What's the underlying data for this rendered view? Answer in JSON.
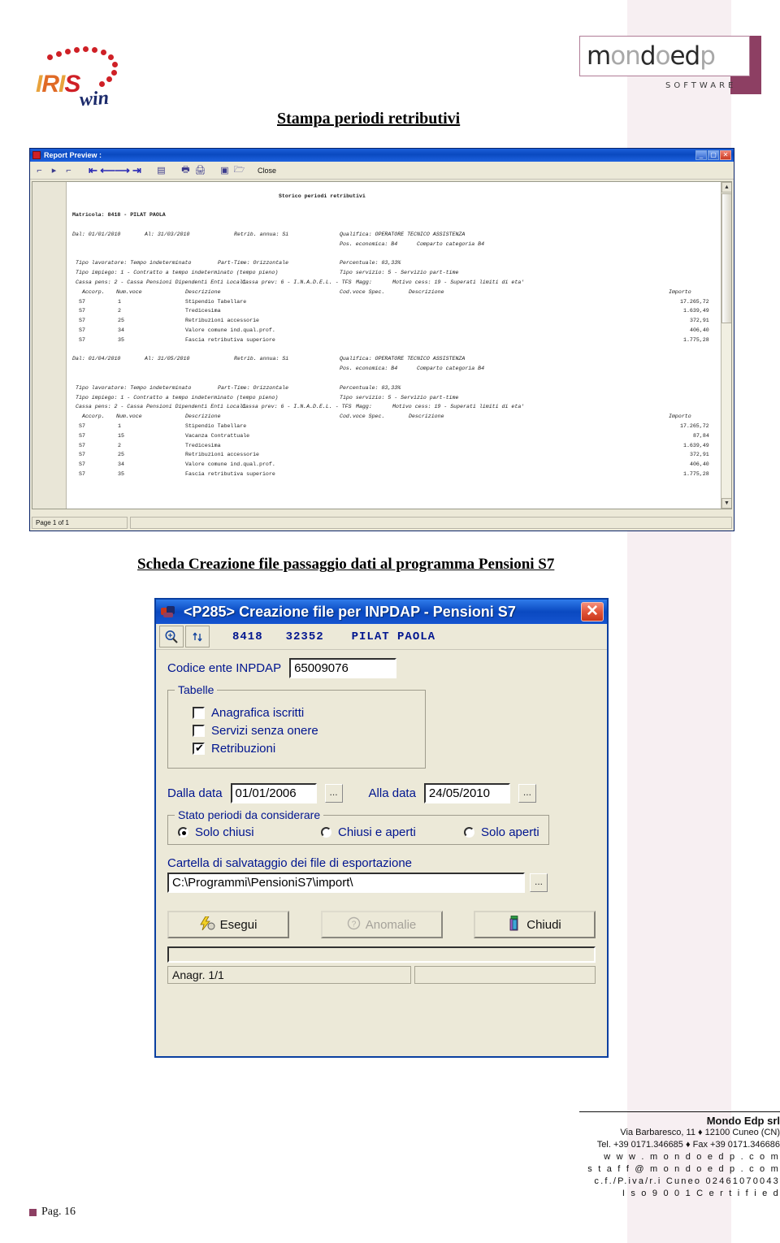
{
  "brand": {
    "iris_logo": {
      "part1": "IRI",
      "part2": "S",
      "script": "win"
    },
    "mondoedp": {
      "word1": "mond",
      "word2": "o",
      "word3": "ed",
      "word4": "p",
      "tagline": "SOFTWARE"
    }
  },
  "headings": {
    "stampa": "Stampa periodi retributivi",
    "scheda": "Scheda Creazione file passaggio dati al programma Pensioni S7"
  },
  "report_window": {
    "title": "Report Preview :",
    "toolbar": {
      "close_label": "Close"
    },
    "status": {
      "page": "Page 1 of 1",
      "right": ""
    },
    "report": {
      "doc_title": "Storico periodi retributivi",
      "matricola": "Matricola: 8418 - PILAT PAOLA",
      "blocks": [
        {
          "dal": "Dal: 01/01/2010",
          "al": "Al: 31/03/2010",
          "retrib_annua": "Retrib. annua: Si",
          "qualifica": "Qualifica: OPERATORE TECNICO ASSISTENZA",
          "pos_economica": "Pos. economica: B4",
          "comparto": "Comparto categoria B4",
          "tipo_lavoratore": "Tipo lavoratore: Tempo indeterminato",
          "part_time": "Part-Time: Orizzontale",
          "percentuale": "Percentuale: 83,33%",
          "tipo_impiego": "Tipo impiego: 1 - Contratto a tempo indeterminato (tempo pieno)",
          "tipo_servizio": "Tipo servizio: 5 - Servizio part-time",
          "cassa_pens": "Cassa pens: 2 - Cassa Pensioni Dipendenti Enti Locali",
          "cassa_prev": "Cassa prev: 6 - I.N.A.D.E.L. - TFS",
          "magg": "Magg:",
          "motivo_cess": "Motivo cess: 19 - Superati limiti di eta'",
          "columns": [
            "Accorp.",
            "Num.voce",
            "Descrizione",
            "Cod.voce Spec.",
            "Descrizione",
            "Importo"
          ],
          "rows": [
            {
              "accorp": "S7",
              "num": "1",
              "descrizione": "Stipendio Tabellare",
              "importo": "17.265,72"
            },
            {
              "accorp": "S7",
              "num": "2",
              "descrizione": "Tredicesima",
              "importo": "1.639,49"
            },
            {
              "accorp": "S7",
              "num": "25",
              "descrizione": "Retribuzioni accessorie",
              "importo": "372,91"
            },
            {
              "accorp": "S7",
              "num": "34",
              "descrizione": "Valore comune ind.qual.prof.",
              "importo": "406,40"
            },
            {
              "accorp": "S7",
              "num": "35",
              "descrizione": "Fascia retributiva superiore",
              "importo": "1.775,28"
            }
          ]
        },
        {
          "dal": "Dal: 01/04/2010",
          "al": "Al: 31/05/2010",
          "retrib_annua": "Retrib. annua: Si",
          "qualifica": "Qualifica: OPERATORE TECNICO ASSISTENZA",
          "pos_economica": "Pos. economica: B4",
          "comparto": "Comparto categoria B4",
          "tipo_lavoratore": "Tipo lavoratore: Tempo indeterminato",
          "part_time": "Part-Time: Orizzontale",
          "percentuale": "Percentuale: 83,33%",
          "tipo_impiego": "Tipo impiego: 1 - Contratto a tempo indeterminato (tempo pieno)",
          "tipo_servizio": "Tipo servizio: 5 - Servizio part-time",
          "cassa_pens": "Cassa pens: 2 - Cassa Pensioni Dipendenti Enti Locali",
          "cassa_prev": "Cassa prev: 6 - I.N.A.D.E.L. - TFS",
          "magg": "Magg:",
          "motivo_cess": "Motivo cess: 19 - Superati limiti di eta'",
          "columns": [
            "Accorp.",
            "Num.voce",
            "Descrizione",
            "Cod.voce Spec.",
            "Descrizione",
            "Importo"
          ],
          "rows": [
            {
              "accorp": "S7",
              "num": "1",
              "descrizione": "Stipendio Tabellare",
              "importo": "17.265,72"
            },
            {
              "accorp": "S7",
              "num": "15",
              "descrizione": "Vacanza Contrattuale",
              "importo": "87,84"
            },
            {
              "accorp": "S7",
              "num": "2",
              "descrizione": "Tredicesima",
              "importo": "1.639,49"
            },
            {
              "accorp": "S7",
              "num": "25",
              "descrizione": "Retribuzioni accessorie",
              "importo": "372,91"
            },
            {
              "accorp": "S7",
              "num": "34",
              "descrizione": "Valore comune ind.qual.prof.",
              "importo": "406,40"
            },
            {
              "accorp": "S7",
              "num": "35",
              "descrizione": "Fascia retributiva superiore",
              "importo": "1.775,28"
            }
          ]
        }
      ]
    }
  },
  "dialog": {
    "title": "<P285> Creazione file per INPDAP - Pensioni S7",
    "close_glyph": "✕",
    "subbar": {
      "matricola": "8418",
      "codice": "32352",
      "nome": "PILAT PAOLA"
    },
    "codice_ente": {
      "label": "Codice ente INPDAP",
      "value": "65009076"
    },
    "tabelle": {
      "title": "Tabelle",
      "items": [
        {
          "label": "Anagrafica iscritti",
          "checked": false
        },
        {
          "label": "Servizi senza onere",
          "checked": false
        },
        {
          "label": "Retribuzioni",
          "checked": true
        }
      ]
    },
    "dates": {
      "from_label": "Dalla data",
      "from_value": "01/01/2006",
      "to_label": "Alla data",
      "to_value": "24/05/2010",
      "browse": "..."
    },
    "stato": {
      "title": "Stato periodi da considerare",
      "options": [
        {
          "label": "Solo chiusi",
          "selected": true
        },
        {
          "label": "Chiusi e aperti",
          "selected": false
        },
        {
          "label": "Solo aperti",
          "selected": false
        }
      ]
    },
    "cartella": {
      "label": "Cartella di salvataggio dei file di esportazione",
      "value": "C:\\Programmi\\PensioniS7\\import\\",
      "browse": "..."
    },
    "buttons": [
      {
        "name": "esegui",
        "label": "Esegui",
        "disabled": false
      },
      {
        "name": "anomalie",
        "label": "Anomalie",
        "disabled": true
      },
      {
        "name": "chiudi",
        "label": "Chiudi",
        "disabled": false
      }
    ],
    "status": {
      "left": "Anagr. 1/1",
      "right": ""
    }
  },
  "footer": {
    "company": "Mondo Edp srl",
    "address": "Via Barbaresco, 11 ♦ 12100 Cuneo (CN)",
    "phone": "Tel. +39 0171.346685 ♦ Fax +39 0171.346686",
    "web": "w w w . m o n d o e d p . c o m",
    "mail": "s t a f f @ m o n d o e d p . c o m",
    "vat": "c.f./P.iva/r.i  Cuneo  02461070043",
    "iso": "I s o 9 0 0 1          C e r t i f i e d",
    "page": "Pag. 16"
  }
}
